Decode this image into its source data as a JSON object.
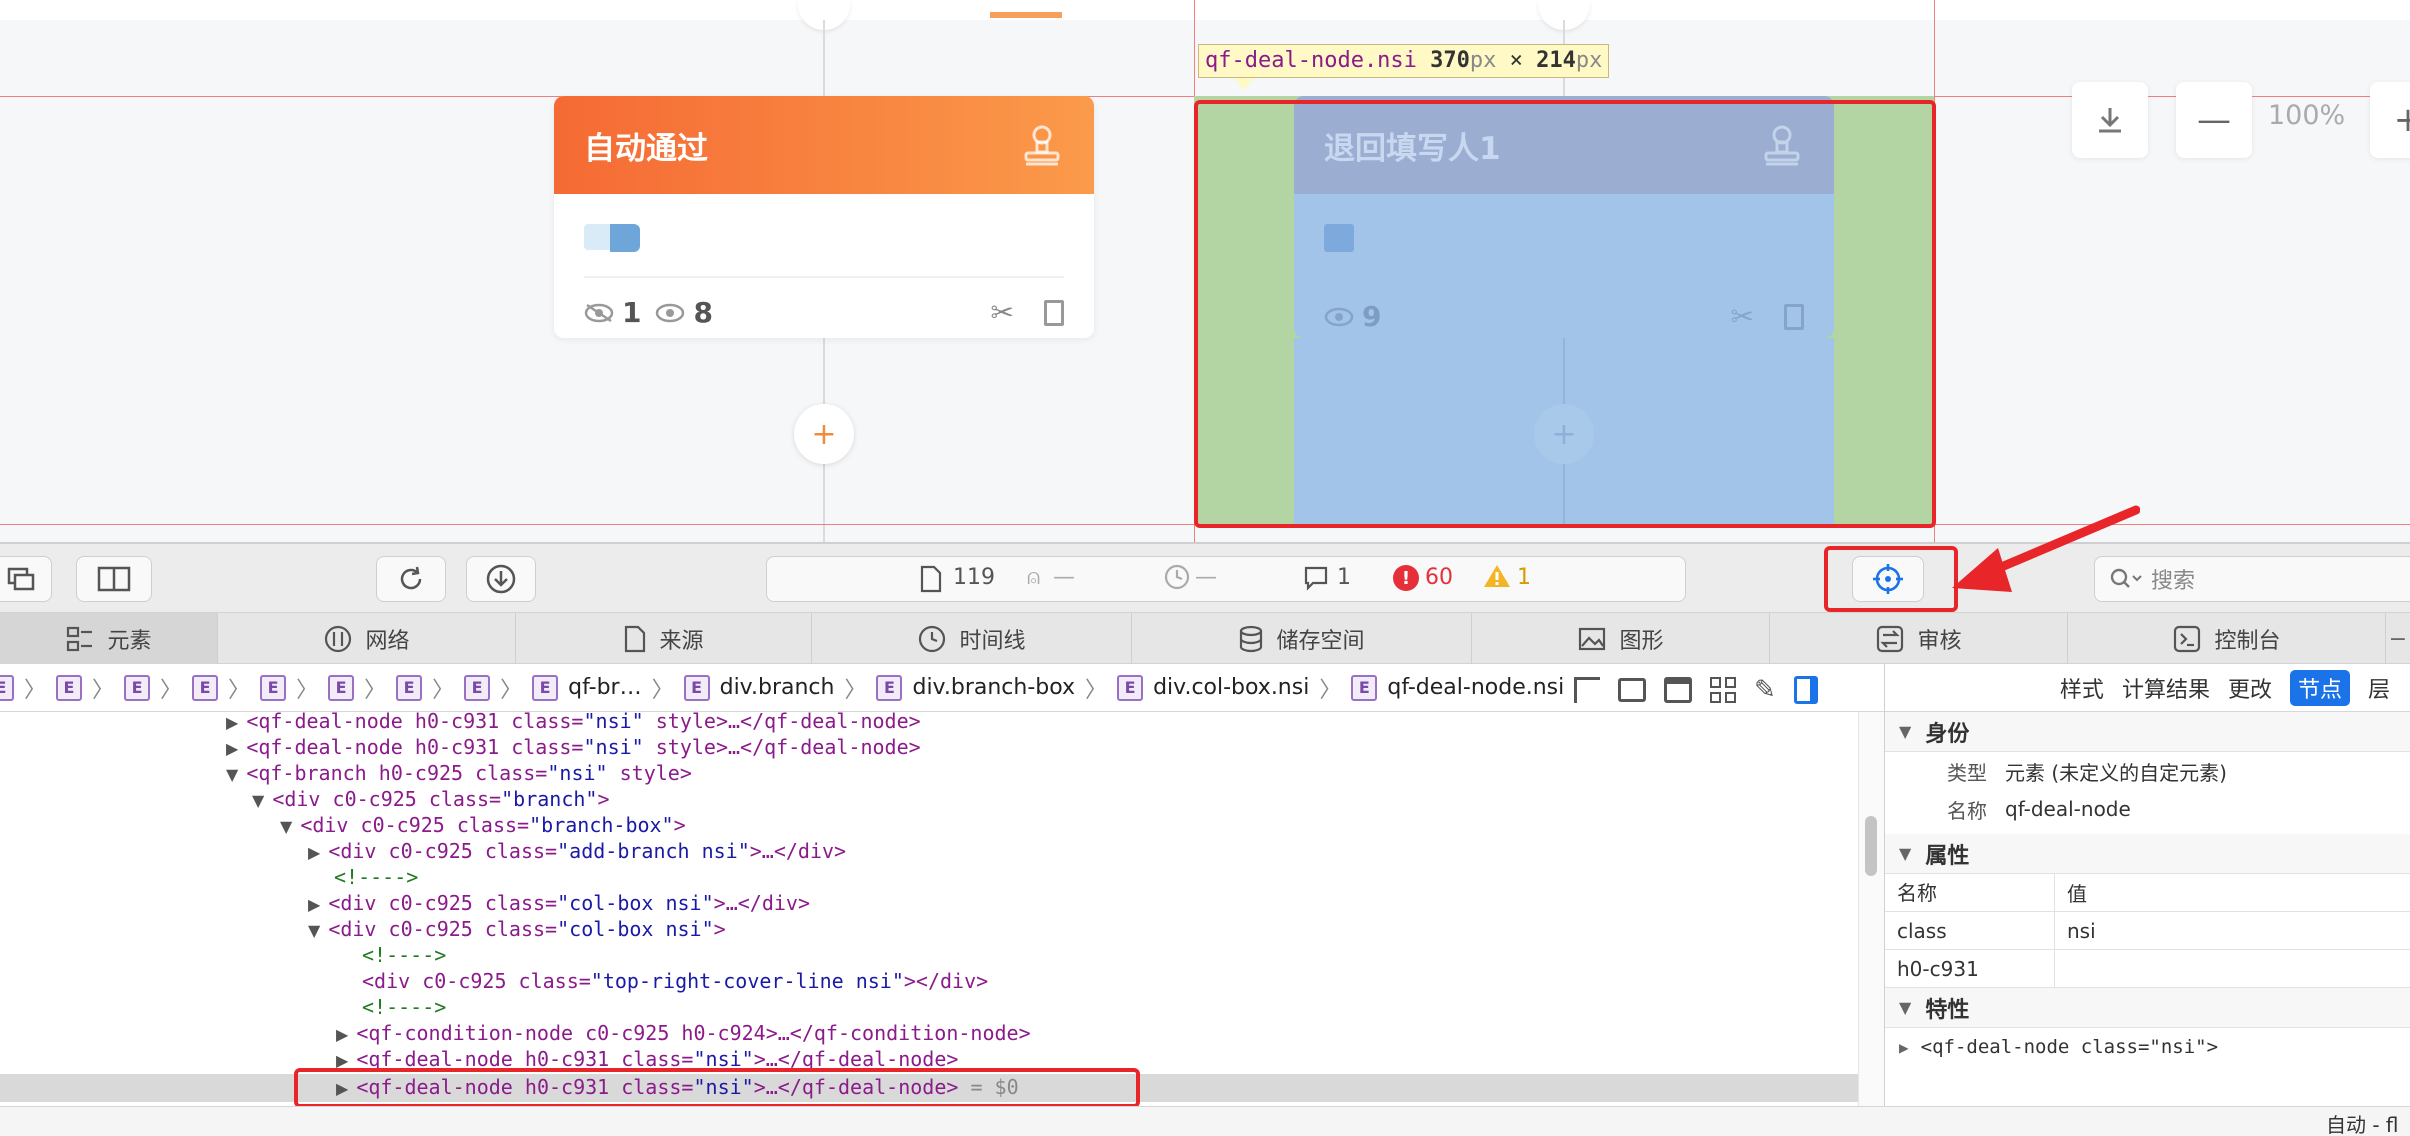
{
  "canvas": {
    "tooltip": {
      "name": "qf-deal-node.nsi",
      "w": "370",
      "h": "214",
      "unit": "px",
      "times": "×"
    },
    "node_auto": {
      "title": "自动通过",
      "hidden_count": "1",
      "view_count": "8"
    },
    "node_return": {
      "title": "退回填写人1",
      "view_count": "9"
    },
    "zoom": {
      "level": "100%"
    },
    "plus_symbol": "+"
  },
  "toolbar": {
    "resources_count": "119",
    "time_dash": "—",
    "load_dash": "—",
    "messages_count": "1",
    "errors_count": "60",
    "warnings_count": "1",
    "search_placeholder": "搜索"
  },
  "tabs": [
    {
      "label": "元素",
      "icon": "elements-icon"
    },
    {
      "label": "网络",
      "icon": "network-icon"
    },
    {
      "label": "来源",
      "icon": "sources-icon"
    },
    {
      "label": "时间线",
      "icon": "timeline-icon"
    },
    {
      "label": "储存空间",
      "icon": "storage-icon"
    },
    {
      "label": "图形",
      "icon": "graphics-icon"
    },
    {
      "label": "审核",
      "icon": "audit-icon"
    },
    {
      "label": "控制台",
      "icon": "console-icon"
    }
  ],
  "breadcrumb": {
    "e_label": "E",
    "items": [
      "qf-br…",
      "div.branch",
      "div.branch-box",
      "div.col-box.nsi",
      "qf-deal-node.nsi"
    ]
  },
  "dom_tree": {
    "l1": {
      "tag": "<qf-deal-node",
      "attr": " h0-c931 class=",
      "val": "\"nsi\"",
      "rest": " style>…</qf-deal-node>"
    },
    "l2": {
      "tag": "<qf-deal-node",
      "attr": " h0-c931 class=",
      "val": "\"nsi\"",
      "rest": " style>…</qf-deal-node>"
    },
    "l3": {
      "tag": "<qf-branch",
      "attr": " h0-c925 class=",
      "val": "\"nsi\"",
      "rest": " style>"
    },
    "l4": {
      "tag": "<div",
      "attr": " c0-c925 class=",
      "val": "\"branch\"",
      "rest": ">"
    },
    "l5": {
      "tag": "<div",
      "attr": " c0-c925 class=",
      "val": "\"branch-box\"",
      "rest": ">"
    },
    "l6": {
      "tag": "<div",
      "attr": " c0-c925 class=",
      "val": "\"add-branch nsi\"",
      "rest": ">…</div>"
    },
    "l7": {
      "text": "<!---->"
    },
    "l8": {
      "tag": "<div",
      "attr": " c0-c925 class=",
      "val": "\"col-box nsi\"",
      "rest": ">…</div>"
    },
    "l9": {
      "tag": "<div",
      "attr": " c0-c925 class=",
      "val": "\"col-box nsi\"",
      "rest": ">"
    },
    "l10": {
      "text": "<!---->"
    },
    "l11": {
      "tag": "<div",
      "attr": " c0-c925 class=",
      "val": "\"top-right-cover-line nsi\"",
      "rest": "></div>"
    },
    "l12": {
      "text": "<!---->"
    },
    "l13": {
      "tag": "<qf-condition-node",
      "attr": " c0-c925 h0-c924",
      "val": "",
      "rest": ">…</qf-condition-node>"
    },
    "l14": {
      "tag": "<qf-deal-node",
      "attr": " h0-c931 class=",
      "val": "\"nsi\"",
      "rest": ">…</qf-deal-node>"
    },
    "l15": {
      "tag": "<qf-deal-node",
      "attr": " h0-c931 class=",
      "val": "\"nsi\"",
      "rest": ">…</qf-deal-node>",
      "suffix": " = $0"
    }
  },
  "side": {
    "tabs": [
      "样式",
      "计算结果",
      "更改",
      "节点",
      "层"
    ],
    "identity_title": "身份",
    "type_label": "类型",
    "type_value": "元素 (未定义的自定元素)",
    "name_label": "名称",
    "name_value": "qf-deal-node",
    "attrs_title": "属性",
    "col_name": "名称",
    "col_value": "值",
    "attr1_name": "class",
    "attr1_value": "nsi",
    "attr2_name": "h0-c931",
    "props_title": "特性",
    "props_item": "<qf-deal-node class=\"nsi\">"
  },
  "statusbar": {
    "text": "自动 - fl"
  },
  "colors": {
    "orange": "#f7793a",
    "highlight_blue": "#9fc3e7",
    "highlight_green": "#b3d5a4",
    "red_annot": "#e8262a"
  }
}
